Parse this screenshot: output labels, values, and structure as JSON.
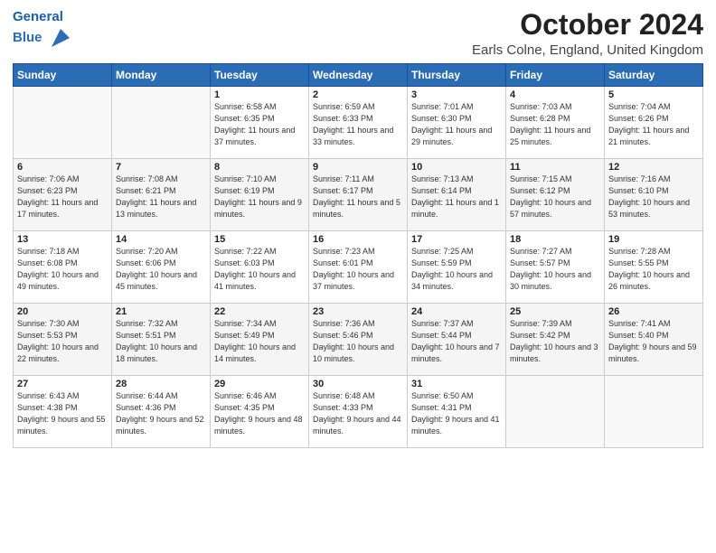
{
  "header": {
    "logo_line1": "General",
    "logo_line2": "Blue",
    "month_title": "October 2024",
    "location": "Earls Colne, England, United Kingdom"
  },
  "weekdays": [
    "Sunday",
    "Monday",
    "Tuesday",
    "Wednesday",
    "Thursday",
    "Friday",
    "Saturday"
  ],
  "weeks": [
    [
      {
        "day": "",
        "info": ""
      },
      {
        "day": "",
        "info": ""
      },
      {
        "day": "1",
        "info": "Sunrise: 6:58 AM\nSunset: 6:35 PM\nDaylight: 11 hours and 37 minutes."
      },
      {
        "day": "2",
        "info": "Sunrise: 6:59 AM\nSunset: 6:33 PM\nDaylight: 11 hours and 33 minutes."
      },
      {
        "day": "3",
        "info": "Sunrise: 7:01 AM\nSunset: 6:30 PM\nDaylight: 11 hours and 29 minutes."
      },
      {
        "day": "4",
        "info": "Sunrise: 7:03 AM\nSunset: 6:28 PM\nDaylight: 11 hours and 25 minutes."
      },
      {
        "day": "5",
        "info": "Sunrise: 7:04 AM\nSunset: 6:26 PM\nDaylight: 11 hours and 21 minutes."
      }
    ],
    [
      {
        "day": "6",
        "info": "Sunrise: 7:06 AM\nSunset: 6:23 PM\nDaylight: 11 hours and 17 minutes."
      },
      {
        "day": "7",
        "info": "Sunrise: 7:08 AM\nSunset: 6:21 PM\nDaylight: 11 hours and 13 minutes."
      },
      {
        "day": "8",
        "info": "Sunrise: 7:10 AM\nSunset: 6:19 PM\nDaylight: 11 hours and 9 minutes."
      },
      {
        "day": "9",
        "info": "Sunrise: 7:11 AM\nSunset: 6:17 PM\nDaylight: 11 hours and 5 minutes."
      },
      {
        "day": "10",
        "info": "Sunrise: 7:13 AM\nSunset: 6:14 PM\nDaylight: 11 hours and 1 minute."
      },
      {
        "day": "11",
        "info": "Sunrise: 7:15 AM\nSunset: 6:12 PM\nDaylight: 10 hours and 57 minutes."
      },
      {
        "day": "12",
        "info": "Sunrise: 7:16 AM\nSunset: 6:10 PM\nDaylight: 10 hours and 53 minutes."
      }
    ],
    [
      {
        "day": "13",
        "info": "Sunrise: 7:18 AM\nSunset: 6:08 PM\nDaylight: 10 hours and 49 minutes."
      },
      {
        "day": "14",
        "info": "Sunrise: 7:20 AM\nSunset: 6:06 PM\nDaylight: 10 hours and 45 minutes."
      },
      {
        "day": "15",
        "info": "Sunrise: 7:22 AM\nSunset: 6:03 PM\nDaylight: 10 hours and 41 minutes."
      },
      {
        "day": "16",
        "info": "Sunrise: 7:23 AM\nSunset: 6:01 PM\nDaylight: 10 hours and 37 minutes."
      },
      {
        "day": "17",
        "info": "Sunrise: 7:25 AM\nSunset: 5:59 PM\nDaylight: 10 hours and 34 minutes."
      },
      {
        "day": "18",
        "info": "Sunrise: 7:27 AM\nSunset: 5:57 PM\nDaylight: 10 hours and 30 minutes."
      },
      {
        "day": "19",
        "info": "Sunrise: 7:28 AM\nSunset: 5:55 PM\nDaylight: 10 hours and 26 minutes."
      }
    ],
    [
      {
        "day": "20",
        "info": "Sunrise: 7:30 AM\nSunset: 5:53 PM\nDaylight: 10 hours and 22 minutes."
      },
      {
        "day": "21",
        "info": "Sunrise: 7:32 AM\nSunset: 5:51 PM\nDaylight: 10 hours and 18 minutes."
      },
      {
        "day": "22",
        "info": "Sunrise: 7:34 AM\nSunset: 5:49 PM\nDaylight: 10 hours and 14 minutes."
      },
      {
        "day": "23",
        "info": "Sunrise: 7:36 AM\nSunset: 5:46 PM\nDaylight: 10 hours and 10 minutes."
      },
      {
        "day": "24",
        "info": "Sunrise: 7:37 AM\nSunset: 5:44 PM\nDaylight: 10 hours and 7 minutes."
      },
      {
        "day": "25",
        "info": "Sunrise: 7:39 AM\nSunset: 5:42 PM\nDaylight: 10 hours and 3 minutes."
      },
      {
        "day": "26",
        "info": "Sunrise: 7:41 AM\nSunset: 5:40 PM\nDaylight: 9 hours and 59 minutes."
      }
    ],
    [
      {
        "day": "27",
        "info": "Sunrise: 6:43 AM\nSunset: 4:38 PM\nDaylight: 9 hours and 55 minutes."
      },
      {
        "day": "28",
        "info": "Sunrise: 6:44 AM\nSunset: 4:36 PM\nDaylight: 9 hours and 52 minutes."
      },
      {
        "day": "29",
        "info": "Sunrise: 6:46 AM\nSunset: 4:35 PM\nDaylight: 9 hours and 48 minutes."
      },
      {
        "day": "30",
        "info": "Sunrise: 6:48 AM\nSunset: 4:33 PM\nDaylight: 9 hours and 44 minutes."
      },
      {
        "day": "31",
        "info": "Sunrise: 6:50 AM\nSunset: 4:31 PM\nDaylight: 9 hours and 41 minutes."
      },
      {
        "day": "",
        "info": ""
      },
      {
        "day": "",
        "info": ""
      }
    ]
  ]
}
